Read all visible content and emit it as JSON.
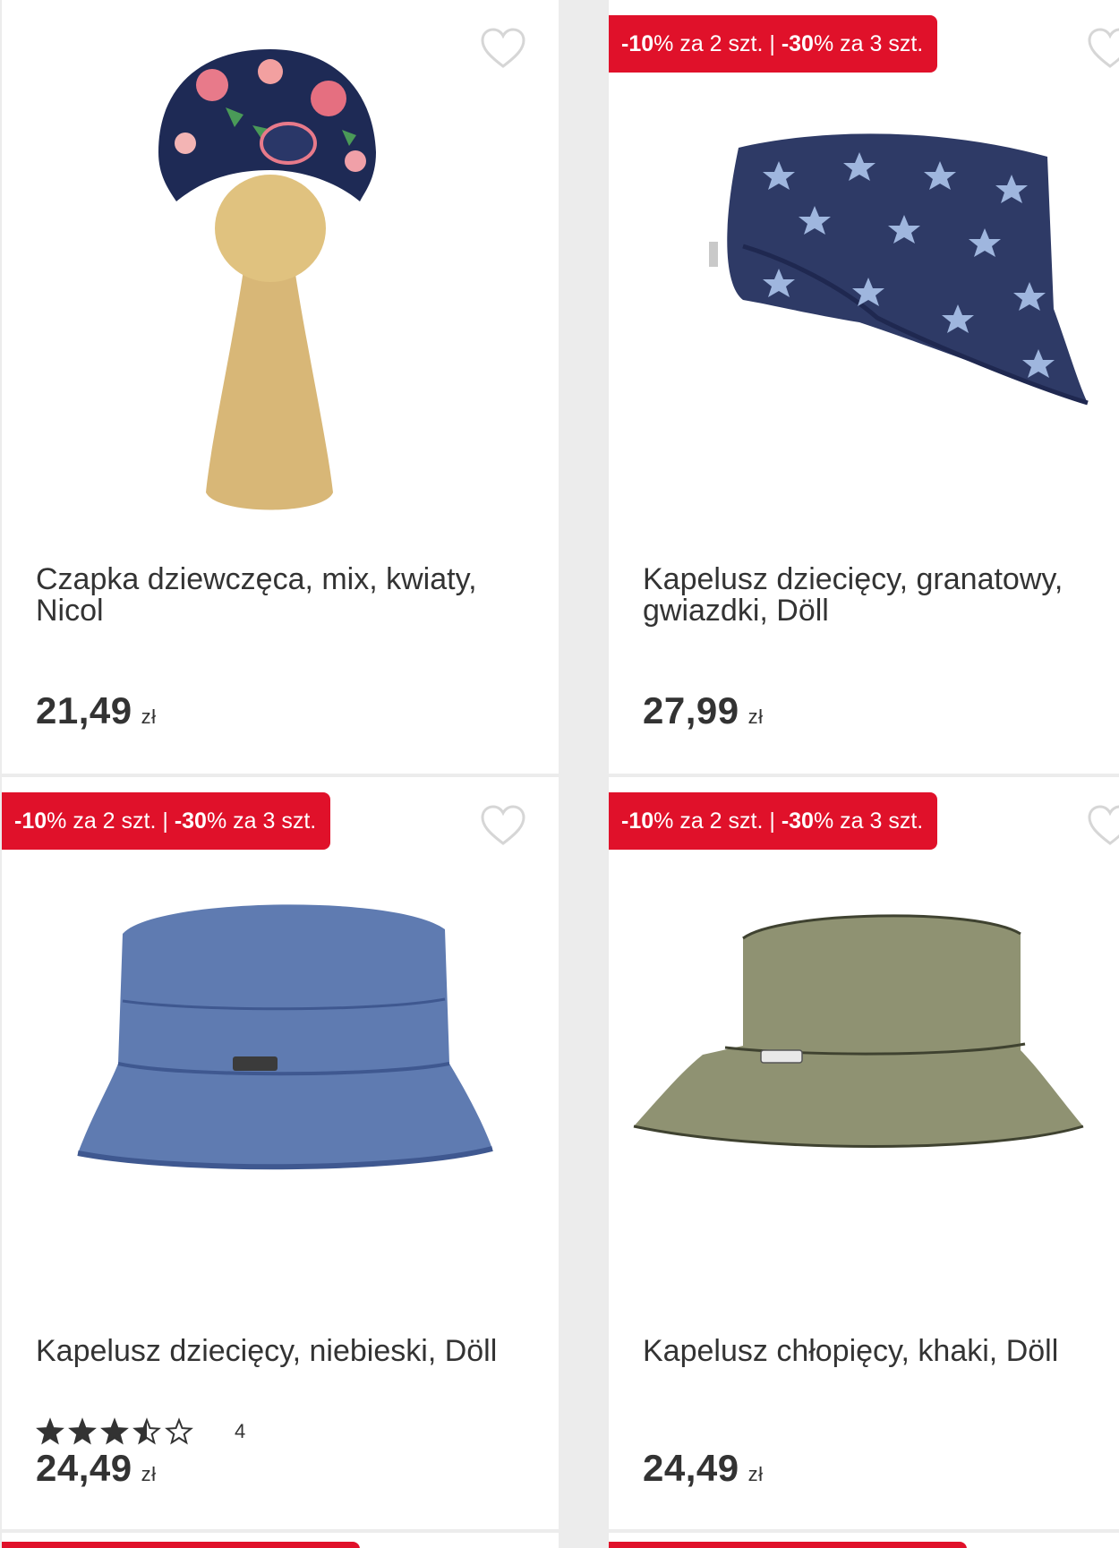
{
  "promo": {
    "pct1": "-10",
    "pct_sign": "%",
    "qty1": " za 2 szt. | ",
    "pct2": "-30",
    "qty2": " za 3 szt."
  },
  "products": [
    {
      "name": "Czapka dziewczęca, mix, kwiaty, Nicol",
      "price": "21,49",
      "currency": "zł",
      "has_promo": false
    },
    {
      "name": "Kapelusz dziecięcy, granatowy, gwiazdki, Döll",
      "price": "27,99",
      "currency": "zł",
      "has_promo": true
    },
    {
      "name": "Kapelusz dziecięcy, niebieski, Döll",
      "price": "24,49",
      "currency": "zł",
      "has_promo": true,
      "rating": 3.5,
      "rating_max": 5,
      "review_count": "4"
    },
    {
      "name": "Kapelusz chłopięcy, khaki, Döll",
      "price": "24,49",
      "currency": "zł",
      "has_promo": true
    }
  ],
  "colors": {
    "promo_bg": "#e0112a",
    "text": "#333333",
    "background": "#ececec"
  },
  "icons": {
    "favorite": "heart-outline-icon",
    "star_full": "star-filled-icon",
    "star_half": "star-half-icon",
    "star_empty": "star-outline-icon"
  }
}
